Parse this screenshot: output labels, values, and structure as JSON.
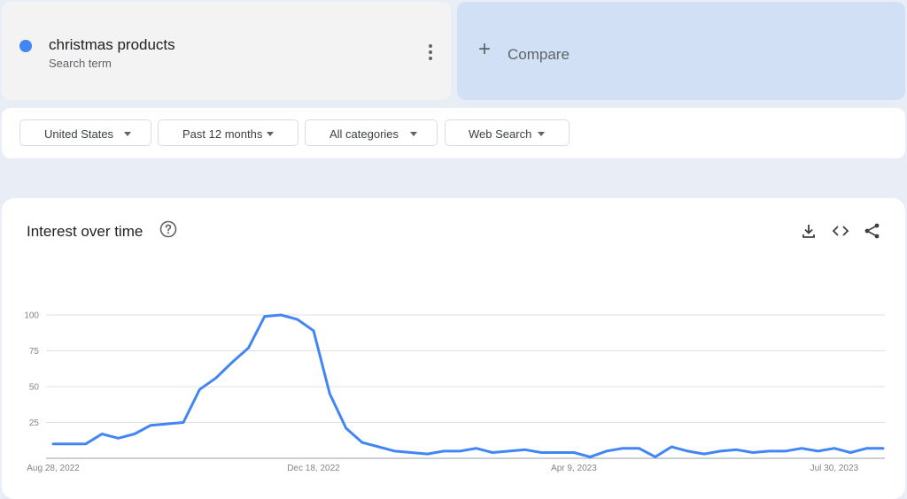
{
  "search_term": {
    "name": "christmas products",
    "type": "Search term",
    "color": "#4285f4"
  },
  "compare": {
    "label": "Compare"
  },
  "filters": {
    "region": "United States",
    "time": "Past 12 months",
    "category": "All categories",
    "property": "Web Search"
  },
  "chart": {
    "title": "Interest over time",
    "icons": [
      "help-icon",
      "download-icon",
      "embed-icon",
      "share-icon"
    ]
  },
  "chart_data": {
    "type": "line",
    "title": "Interest over time",
    "ylim": [
      0,
      100
    ],
    "yticks": [
      25,
      50,
      75,
      100
    ],
    "xtick_labels": [
      "Aug 28, 2022",
      "Dec 18, 2022",
      "Apr 9, 2023",
      "Jul 30, 2023"
    ],
    "xtick_index": [
      0,
      16,
      32,
      48
    ],
    "grid": true,
    "series": [
      {
        "name": "christmas products",
        "color": "#4285f4",
        "values": [
          10,
          10,
          10,
          17,
          14,
          17,
          23,
          24,
          25,
          48,
          56,
          67,
          77,
          99,
          100,
          97,
          89,
          45,
          21,
          11,
          8,
          5,
          4,
          3,
          5,
          5,
          7,
          4,
          5,
          6,
          4,
          4,
          4,
          1,
          5,
          7,
          7,
          1,
          8,
          5,
          3,
          5,
          6,
          4,
          5,
          5,
          7,
          5,
          7,
          4,
          7,
          7
        ]
      }
    ]
  }
}
